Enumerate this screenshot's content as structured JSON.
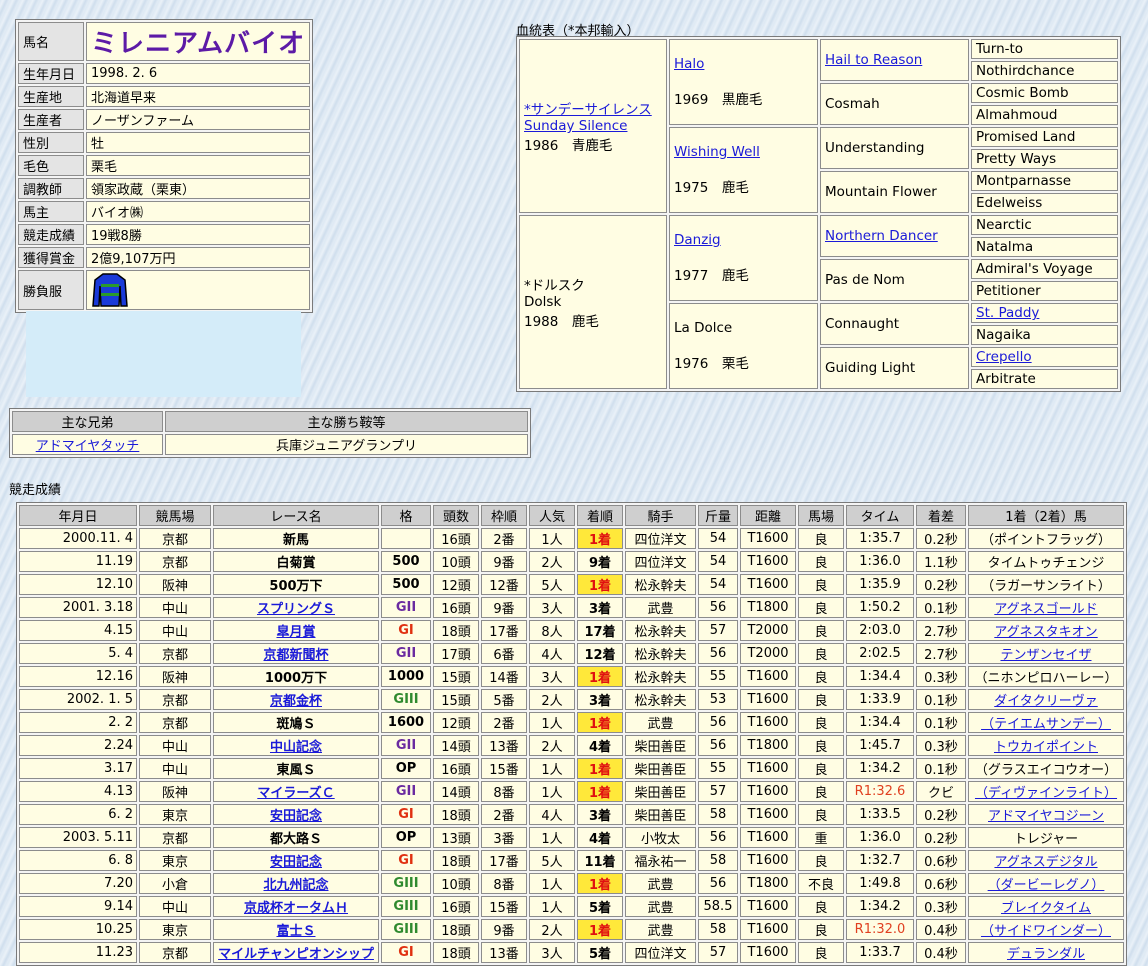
{
  "profile": {
    "rows": [
      {
        "label": "馬名",
        "value": "ミレニアムバイオ"
      },
      {
        "label": "生年月日",
        "value": "1998. 2. 6"
      },
      {
        "label": "生産地",
        "value": "北海道早来"
      },
      {
        "label": "生産者",
        "value": "ノーザンファーム"
      },
      {
        "label": "性別",
        "value": "牡"
      },
      {
        "label": "毛色",
        "value": "栗毛"
      },
      {
        "label": "調教師",
        "value": "領家政蔵（栗東）"
      },
      {
        "label": "馬主",
        "value": "バイオ㈱"
      },
      {
        "label": "競走成績",
        "value": "19戦8勝"
      },
      {
        "label": "獲得賞金",
        "value": "2億9,107万円"
      },
      {
        "label": "勝負服",
        "value": ""
      }
    ],
    "silks_colors": {
      "body": "#1a3ad8",
      "stripe": "#2a9a2a",
      "outline": "#000000"
    }
  },
  "pedigree": {
    "title": "血統表（*本邦輸入）",
    "sire": {
      "name1": "*サンデーサイレンス",
      "name2": "Sunday Silence",
      "year": "1986",
      "color": "青鹿毛",
      "link": true
    },
    "sire_sire": {
      "name": "Halo",
      "year": "1969",
      "color": "黒鹿毛",
      "link": true
    },
    "sire_dam": {
      "name": "Wishing Well",
      "year": "1975",
      "color": "鹿毛",
      "link": true
    },
    "dam": {
      "name1": "*ドルスク",
      "name2": "Dolsk",
      "year": "1988",
      "color": "鹿毛",
      "link": false
    },
    "dam_sire": {
      "name": "Danzig",
      "year": "1977",
      "color": "鹿毛",
      "link": true
    },
    "dam_dam": {
      "name": "La Dolce",
      "year": "1976",
      "color": "栗毛",
      "link": false
    },
    "gen3": [
      {
        "name": "Hail to Reason",
        "link": true
      },
      {
        "name": "Cosmah",
        "link": false
      },
      {
        "name": "Understanding",
        "link": false
      },
      {
        "name": "Mountain Flower",
        "link": false
      },
      {
        "name": "Northern Dancer",
        "link": true
      },
      {
        "name": "Pas de Nom",
        "link": false
      },
      {
        "name": "Connaught",
        "link": false
      },
      {
        "name": "Guiding Light",
        "link": false
      }
    ],
    "gen4": [
      {
        "name": "Turn-to",
        "link": false
      },
      {
        "name": "Nothirdchance",
        "link": false
      },
      {
        "name": "Cosmic Bomb",
        "link": false
      },
      {
        "name": "Almahmoud",
        "link": false
      },
      {
        "name": "Promised Land",
        "link": false
      },
      {
        "name": "Pretty Ways",
        "link": false
      },
      {
        "name": "Montparnasse",
        "link": false
      },
      {
        "name": "Edelweiss",
        "link": false
      },
      {
        "name": "Nearctic",
        "link": false
      },
      {
        "name": "Natalma",
        "link": false
      },
      {
        "name": "Admiral's Voyage",
        "link": false
      },
      {
        "name": "Petitioner",
        "link": false
      },
      {
        "name": "St. Paddy",
        "link": true
      },
      {
        "name": "Nagaika",
        "link": false
      },
      {
        "name": "Crepello",
        "link": true
      },
      {
        "name": "Arbitrate",
        "link": false
      }
    ]
  },
  "siblings": {
    "headers": [
      "主な兄弟",
      "主な勝ち鞍等"
    ],
    "rows": [
      {
        "name": "アドマイヤタッチ",
        "wins": "兵庫ジュニアグランプリ"
      }
    ]
  },
  "results": {
    "title": "競走成績",
    "headers": [
      "年月日",
      "競馬場",
      "レース名",
      "格",
      "頭数",
      "枠順",
      "人気",
      "着順",
      "騎手",
      "斤量",
      "距離",
      "馬場",
      "タイム",
      "着差",
      "1着（2着）馬"
    ],
    "rows": [
      {
        "date": "2000.11. 4",
        "track": "京都",
        "race": "新馬",
        "race_link": false,
        "grade": "",
        "grade_cls": "",
        "runners": "16頭",
        "gate": "2番",
        "pop": "1人",
        "pos": "1着",
        "win": true,
        "jockey": "四位洋文",
        "weight": "54",
        "dist": "T1600",
        "cond": "良",
        "time": "1:35.7",
        "rec": false,
        "margin": "0.2秒",
        "winner": "（ポイントフラッグ）",
        "winner_link": false
      },
      {
        "date": "11.19",
        "track": "京都",
        "race": "白菊賞",
        "race_link": false,
        "grade": "500",
        "grade_cls": "",
        "runners": "10頭",
        "gate": "9番",
        "pop": "2人",
        "pos": "9着",
        "win": false,
        "jockey": "四位洋文",
        "weight": "54",
        "dist": "T1600",
        "cond": "良",
        "time": "1:36.0",
        "rec": false,
        "margin": "1.1秒",
        "winner": "タイムトゥチェンジ",
        "winner_link": false
      },
      {
        "date": "12.10",
        "track": "阪神",
        "race": "500万下",
        "race_link": false,
        "grade": "500",
        "grade_cls": "",
        "runners": "12頭",
        "gate": "12番",
        "pop": "5人",
        "pos": "1着",
        "win": true,
        "jockey": "松永幹夫",
        "weight": "54",
        "dist": "T1600",
        "cond": "良",
        "time": "1:35.9",
        "rec": false,
        "margin": "0.2秒",
        "winner": "（ラガーサンライト）",
        "winner_link": false
      },
      {
        "date": "2001. 3.18",
        "track": "中山",
        "race": "スプリングＳ",
        "race_link": true,
        "grade": "GII",
        "grade_cls": "gG2",
        "runners": "16頭",
        "gate": "9番",
        "pop": "3人",
        "pos": "3着",
        "win": false,
        "jockey": "武豊",
        "weight": "56",
        "dist": "T1800",
        "cond": "良",
        "time": "1:50.2",
        "rec": false,
        "margin": "0.1秒",
        "winner": "アグネスゴールド",
        "winner_link": true
      },
      {
        "date": "4.15",
        "track": "中山",
        "race": "皐月賞",
        "race_link": true,
        "grade": "GI",
        "grade_cls": "gG1",
        "runners": "18頭",
        "gate": "17番",
        "pop": "8人",
        "pos": "17着",
        "win": false,
        "jockey": "松永幹夫",
        "weight": "57",
        "dist": "T2000",
        "cond": "良",
        "time": "2:03.0",
        "rec": false,
        "margin": "2.7秒",
        "winner": "アグネスタキオン",
        "winner_link": true
      },
      {
        "date": "5. 4",
        "track": "京都",
        "race": "京都新聞杯",
        "race_link": true,
        "grade": "GII",
        "grade_cls": "gG2",
        "runners": "17頭",
        "gate": "6番",
        "pop": "4人",
        "pos": "12着",
        "win": false,
        "jockey": "松永幹夫",
        "weight": "56",
        "dist": "T2000",
        "cond": "良",
        "time": "2:02.5",
        "rec": false,
        "margin": "2.7秒",
        "winner": "テンザンセイザ",
        "winner_link": true
      },
      {
        "date": "12.16",
        "track": "阪神",
        "race": "1000万下",
        "race_link": false,
        "grade": "1000",
        "grade_cls": "",
        "runners": "15頭",
        "gate": "14番",
        "pop": "3人",
        "pos": "1着",
        "win": true,
        "jockey": "松永幹夫",
        "weight": "55",
        "dist": "T1600",
        "cond": "良",
        "time": "1:34.4",
        "rec": false,
        "margin": "0.3秒",
        "winner": "（ニホンピロハーレー）",
        "winner_link": false
      },
      {
        "date": "2002. 1. 5",
        "track": "京都",
        "race": "京都金杯",
        "race_link": true,
        "grade": "GIII",
        "grade_cls": "gG3",
        "runners": "15頭",
        "gate": "5番",
        "pop": "2人",
        "pos": "3着",
        "win": false,
        "jockey": "松永幹夫",
        "weight": "53",
        "dist": "T1600",
        "cond": "良",
        "time": "1:33.9",
        "rec": false,
        "margin": "0.1秒",
        "winner": "ダイタクリーヴァ",
        "winner_link": true
      },
      {
        "date": "2. 2",
        "track": "京都",
        "race": "斑鳩Ｓ",
        "race_link": false,
        "grade": "1600",
        "grade_cls": "",
        "runners": "12頭",
        "gate": "2番",
        "pop": "1人",
        "pos": "1着",
        "win": true,
        "jockey": "武豊",
        "weight": "56",
        "dist": "T1600",
        "cond": "良",
        "time": "1:34.4",
        "rec": false,
        "margin": "0.1秒",
        "winner": "（テイエムサンデー）",
        "winner_link": true
      },
      {
        "date": "2.24",
        "track": "中山",
        "race": "中山記念",
        "race_link": true,
        "grade": "GII",
        "grade_cls": "gG2",
        "runners": "14頭",
        "gate": "13番",
        "pop": "2人",
        "pos": "4着",
        "win": false,
        "jockey": "柴田善臣",
        "weight": "56",
        "dist": "T1800",
        "cond": "良",
        "time": "1:45.7",
        "rec": false,
        "margin": "0.3秒",
        "winner": "トウカイポイント",
        "winner_link": true
      },
      {
        "date": "3.17",
        "track": "中山",
        "race": "東風Ｓ",
        "race_link": false,
        "grade": "OP",
        "grade_cls": "gOP",
        "runners": "16頭",
        "gate": "15番",
        "pop": "1人",
        "pos": "1着",
        "win": true,
        "jockey": "柴田善臣",
        "weight": "55",
        "dist": "T1600",
        "cond": "良",
        "time": "1:34.2",
        "rec": false,
        "margin": "0.1秒",
        "winner": "（グラスエイコウオー）",
        "winner_link": false
      },
      {
        "date": "4.13",
        "track": "阪神",
        "race": "マイラーズＣ",
        "race_link": true,
        "grade": "GII",
        "grade_cls": "gG2",
        "runners": "14頭",
        "gate": "8番",
        "pop": "1人",
        "pos": "1着",
        "win": true,
        "jockey": "柴田善臣",
        "weight": "57",
        "dist": "T1600",
        "cond": "良",
        "time": "R1:32.6",
        "rec": true,
        "margin": "クビ",
        "winner": "（ディヴァインライト）",
        "winner_link": true
      },
      {
        "date": "6. 2",
        "track": "東京",
        "race": "安田記念",
        "race_link": true,
        "grade": "GI",
        "grade_cls": "gG1",
        "runners": "18頭",
        "gate": "2番",
        "pop": "4人",
        "pos": "3着",
        "win": false,
        "jockey": "柴田善臣",
        "weight": "58",
        "dist": "T1600",
        "cond": "良",
        "time": "1:33.5",
        "rec": false,
        "margin": "0.2秒",
        "winner": "アドマイヤコジーン",
        "winner_link": true
      },
      {
        "date": "2003. 5.11",
        "track": "京都",
        "race": "都大路Ｓ",
        "race_link": false,
        "grade": "OP",
        "grade_cls": "gOP",
        "runners": "13頭",
        "gate": "3番",
        "pop": "1人",
        "pos": "4着",
        "win": false,
        "jockey": "小牧太",
        "weight": "56",
        "dist": "T1600",
        "cond": "重",
        "time": "1:36.0",
        "rec": false,
        "margin": "0.2秒",
        "winner": "トレジャー",
        "winner_link": false
      },
      {
        "date": "6. 8",
        "track": "東京",
        "race": "安田記念",
        "race_link": true,
        "grade": "GI",
        "grade_cls": "gG1",
        "runners": "18頭",
        "gate": "17番",
        "pop": "5人",
        "pos": "11着",
        "win": false,
        "jockey": "福永祐一",
        "weight": "58",
        "dist": "T1600",
        "cond": "良",
        "time": "1:32.7",
        "rec": false,
        "margin": "0.6秒",
        "winner": "アグネスデジタル",
        "winner_link": true
      },
      {
        "date": "7.20",
        "track": "小倉",
        "race": "北九州記念",
        "race_link": true,
        "grade": "GIII",
        "grade_cls": "gG3",
        "runners": "10頭",
        "gate": "8番",
        "pop": "1人",
        "pos": "1着",
        "win": true,
        "jockey": "武豊",
        "weight": "56",
        "dist": "T1800",
        "cond": "不良",
        "time": "1:49.8",
        "rec": false,
        "margin": "0.6秒",
        "winner": "（ダービーレグノ）",
        "winner_link": true
      },
      {
        "date": "9.14",
        "track": "中山",
        "race": "京成杯オータムＨ",
        "race_link": true,
        "grade": "GIII",
        "grade_cls": "gG3",
        "runners": "16頭",
        "gate": "15番",
        "pop": "1人",
        "pos": "5着",
        "win": false,
        "jockey": "武豊",
        "weight": "58.5",
        "dist": "T1600",
        "cond": "良",
        "time": "1:34.2",
        "rec": false,
        "margin": "0.3秒",
        "winner": "ブレイクタイム",
        "winner_link": true
      },
      {
        "date": "10.25",
        "track": "東京",
        "race": "富士Ｓ",
        "race_link": true,
        "grade": "GIII",
        "grade_cls": "gG3",
        "runners": "18頭",
        "gate": "9番",
        "pop": "2人",
        "pos": "1着",
        "win": true,
        "jockey": "武豊",
        "weight": "58",
        "dist": "T1600",
        "cond": "良",
        "time": "R1:32.0",
        "rec": true,
        "margin": "0.4秒",
        "winner": "（サイドワインダー）",
        "winner_link": true
      },
      {
        "date": "11.23",
        "track": "京都",
        "race": "マイルチャンピオンシップ",
        "race_link": true,
        "grade": "GI",
        "grade_cls": "gG1",
        "runners": "18頭",
        "gate": "13番",
        "pop": "3人",
        "pos": "5着",
        "win": false,
        "jockey": "四位洋文",
        "weight": "57",
        "dist": "T1600",
        "cond": "良",
        "time": "1:33.7",
        "rec": false,
        "margin": "0.4秒",
        "winner": "デュランダル",
        "winner_link": true
      }
    ]
  }
}
